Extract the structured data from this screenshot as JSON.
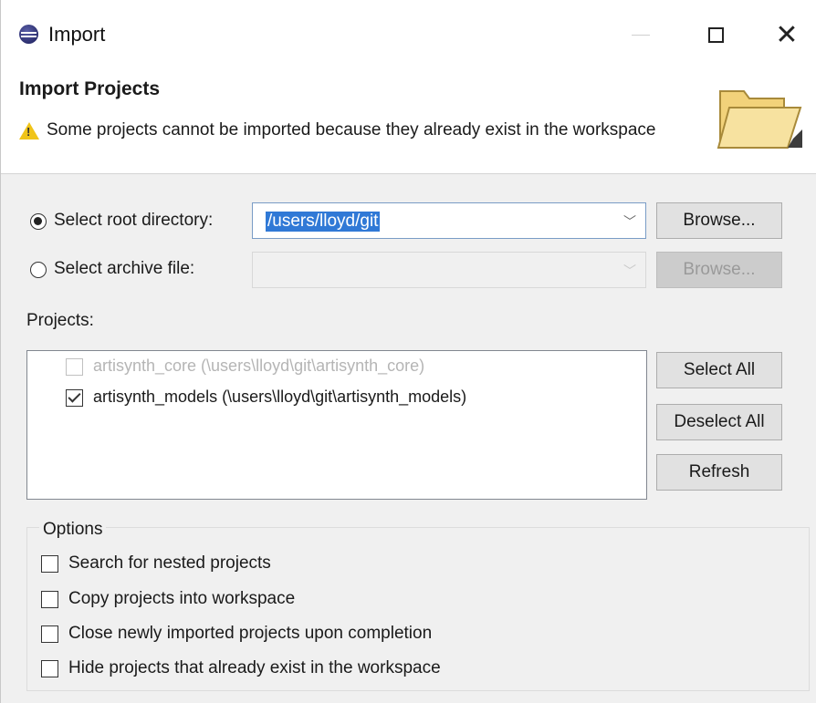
{
  "window": {
    "title": "Import",
    "minimize_icon": "minimize-icon",
    "maximize_icon": "maximize-icon",
    "close_icon": "close-icon"
  },
  "banner": {
    "title": "Import Projects",
    "message": "Some projects cannot be imported because they already exist in the workspace",
    "warning_icon": "warning-icon",
    "folder_icon": "folder-icon"
  },
  "source": {
    "root_directory": {
      "label": "Select root directory:",
      "selected": true,
      "value": "/users/lloyd/git",
      "browse_label": "Browse..."
    },
    "archive_file": {
      "label": "Select archive file:",
      "selected": false,
      "value": "",
      "browse_label": "Browse..."
    }
  },
  "projects": {
    "label": "Projects:",
    "items": [
      {
        "label": "artisynth_core (\\users\\lloyd\\git\\artisynth_core)",
        "checked": false,
        "enabled": false
      },
      {
        "label": "artisynth_models (\\users\\lloyd\\git\\artisynth_models)",
        "checked": true,
        "enabled": true
      }
    ],
    "buttons": {
      "select_all": "Select All",
      "deselect_all": "Deselect All",
      "refresh": "Refresh"
    }
  },
  "options": {
    "title": "Options",
    "items": [
      {
        "label": "Search for nested projects",
        "checked": false
      },
      {
        "label": "Copy projects into workspace",
        "checked": false
      },
      {
        "label": "Close newly imported projects upon completion",
        "checked": false
      },
      {
        "label": "Hide projects that already exist in the workspace",
        "checked": false
      }
    ]
  }
}
